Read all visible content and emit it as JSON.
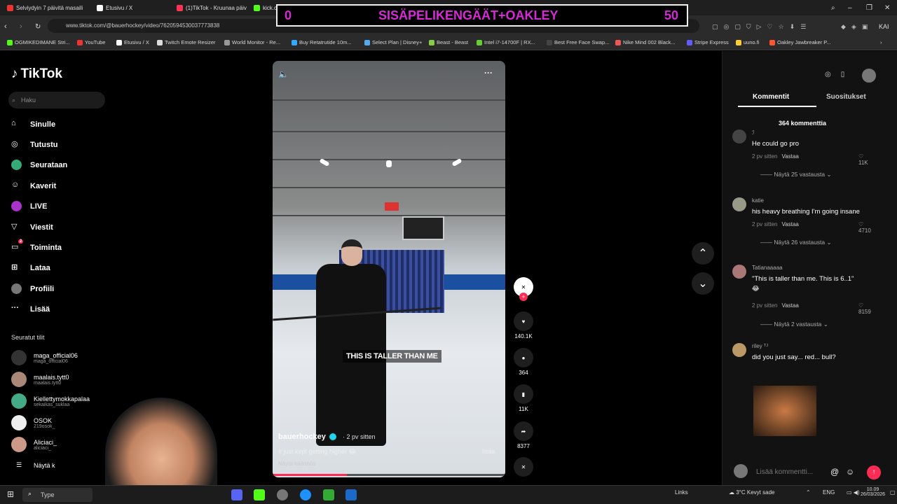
{
  "browser": {
    "tabs": [
      {
        "label": "Selviydyin 7 päivitä masaili",
        "color": "#e33"
      },
      {
        "label": "Etusivu / X",
        "color": "#fff"
      },
      {
        "label": "(1)TikTok - Kruunaa päivite",
        "color": "#ff3355"
      },
      {
        "label": "kick.com",
        "color": "#53fc18"
      }
    ],
    "url": "www.tiktok.com/@bauerhockey/video/7620594530037773838",
    "bookmarks": [
      "OGMIKEDIMANE Stri...",
      "YouTube",
      "Etusivu / X",
      "Twitch Emote Resizer",
      "World Monitor - Re...",
      "Buy Retatrutide 10m...",
      "Select Plan | Disney+",
      "Beast - Beast",
      "Intel i7-14700F | RX...",
      "Best Free Face Swap...",
      "Nike Mind 002 Black...",
      "Stripe Express",
      "uuno.fi",
      "Oakley Jawbreaker P..."
    ]
  },
  "overlay": {
    "left": "0",
    "center": "SISÄPELIKENGÄÄT+OAKLEY",
    "right": "50"
  },
  "sidebar": {
    "brand": "TikTok",
    "search_placeholder": "Haku",
    "nav": [
      {
        "label": "Sinulle",
        "icon": "home-icon"
      },
      {
        "label": "Tutustu",
        "icon": "compass-icon"
      },
      {
        "label": "Seurataan",
        "icon": "following-icon"
      },
      {
        "label": "Kaverit",
        "icon": "friends-icon"
      },
      {
        "label": "LIVE",
        "icon": "live-icon"
      },
      {
        "label": "Viestit",
        "icon": "messages-icon"
      },
      {
        "label": "Toiminta",
        "icon": "activity-icon"
      },
      {
        "label": "Lataa",
        "icon": "upload-icon"
      },
      {
        "label": "Profiili",
        "icon": "profile-icon"
      },
      {
        "label": "Lisää",
        "icon": "more-icon"
      }
    ],
    "activity_badge": "2",
    "following_header": "Seuratut tilit",
    "following": [
      {
        "name": "maga_official06",
        "handle": "maga_official06"
      },
      {
        "name": "maalais.tytt0",
        "handle": "maalais.tytt0"
      },
      {
        "name": "Kiellettymokkapalaa",
        "handle": "sekaikas_suklaa"
      },
      {
        "name": "OSOK",
        "handle": "219osok_"
      },
      {
        "name": "Aliciaci_",
        "handle": "aliciaci_"
      }
    ],
    "show_more": "Näytä k"
  },
  "video": {
    "subtitle": "THIS IS TALLER THAN ME",
    "username": "bauerhockey",
    "time": "· 2 pv sitten",
    "caption": "It just kept getting higher 😂",
    "more": "lisää",
    "translate": "Näytä käännös",
    "progress": 0.32
  },
  "actions": {
    "likes": "140.1K",
    "comments": "364",
    "saves": "11K",
    "shares": "8377"
  },
  "comments": {
    "tabs": [
      "Kommentit",
      "Suositukset"
    ],
    "count": "364 kommenttia",
    "items": [
      {
        "name": "ℐ",
        "text": "He could go pro",
        "time": "2 pv sitten",
        "reply": "Vastaa",
        "likes": "11K",
        "replies": "Näytä 25 vastausta"
      },
      {
        "name": "katie",
        "text": "his heavy breathing I'm going insane",
        "time": "2 pv sitten",
        "reply": "Vastaa",
        "likes": "4710",
        "replies": "Näytä 26 vastausta"
      },
      {
        "name": "Tatianaaaaa",
        "text": "\"This is taller than me. This is 6..1\"",
        "time": "2 pv sitten",
        "reply": "Vastaa",
        "likes": "8159",
        "replies": "Näytä 2 vastausta"
      },
      {
        "name": "riley ᵀᴶ",
        "text": "did you just say... red... bull?",
        "time": "",
        "reply": "",
        "likes": "",
        "replies": ""
      }
    ],
    "input_placeholder": "Lisää kommentti..."
  },
  "taskbar": {
    "search": "Type",
    "links": "Links",
    "weather": "3°C Kevyt sade",
    "lang": "ENG",
    "time": "10.09",
    "date": "26/03/2026"
  }
}
